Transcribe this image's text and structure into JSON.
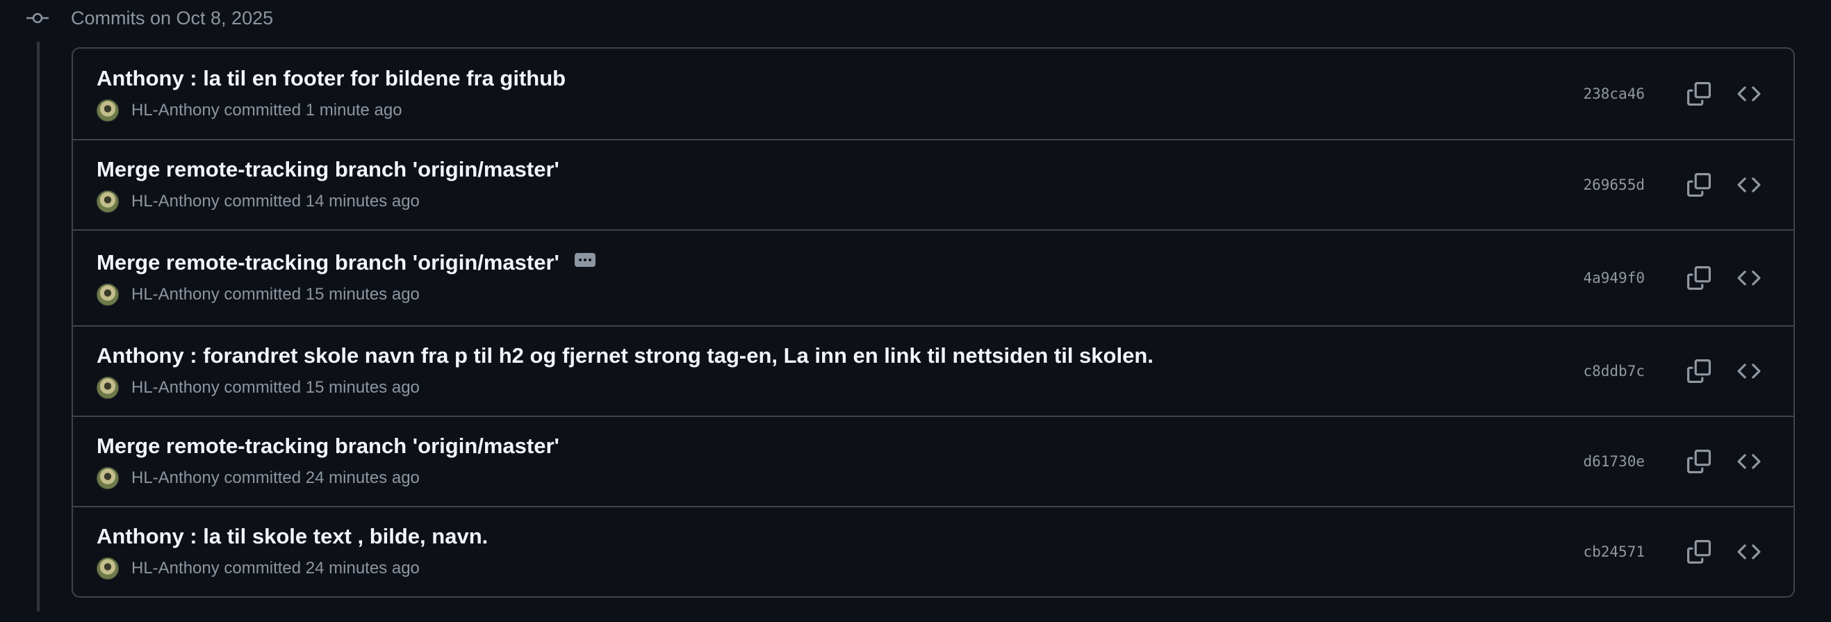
{
  "group": {
    "title": "Commits on Oct 8, 2025",
    "node_icon": "git-commit-icon"
  },
  "colors": {
    "background": "#0d1117",
    "border": "#3d444d",
    "text_primary": "#f0f6fc",
    "text_muted": "#8d96a0"
  },
  "commits": [
    {
      "title": "Anthony : la til en footer for bildene fra github",
      "author": "HL-Anthony",
      "committed_text": "committed 1 minute ago",
      "sha": "238ca46",
      "has_ellipsis": false
    },
    {
      "title": "Merge remote-tracking branch 'origin/master'",
      "author": "HL-Anthony",
      "committed_text": "committed 14 minutes ago",
      "sha": "269655d",
      "has_ellipsis": false
    },
    {
      "title": "Merge remote-tracking branch 'origin/master'",
      "author": "HL-Anthony",
      "committed_text": "committed 15 minutes ago",
      "sha": "4a949f0",
      "has_ellipsis": true
    },
    {
      "title": "Anthony : forandret skole navn fra p til h2 og fjernet strong tag-en, La inn en link til nettsiden til skolen.",
      "author": "HL-Anthony",
      "committed_text": "committed 15 minutes ago",
      "sha": "c8ddb7c",
      "has_ellipsis": false
    },
    {
      "title": "Merge remote-tracking branch 'origin/master'",
      "author": "HL-Anthony",
      "committed_text": "committed 24 minutes ago",
      "sha": "d61730e",
      "has_ellipsis": false
    },
    {
      "title": "Anthony : la til skole text , bilde, navn.",
      "author": "HL-Anthony",
      "committed_text": "committed 24 minutes ago",
      "sha": "cb24571",
      "has_ellipsis": false
    }
  ],
  "icons": {
    "copy": "copy-icon",
    "browse": "code-icon",
    "ellipsis": "ellipsis-icon",
    "avatar": "avatar"
  }
}
